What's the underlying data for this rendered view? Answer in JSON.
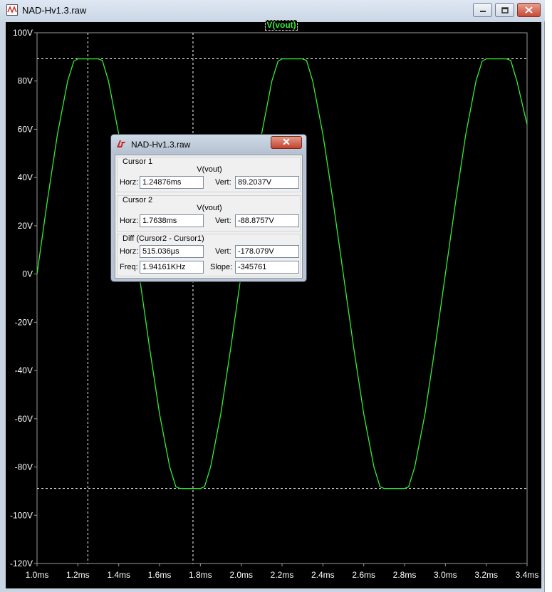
{
  "window": {
    "title": "NAD-Hv1.3.raw",
    "icon": "ltspice-waveform-icon",
    "controls": [
      "minimize-icon",
      "maximize-icon",
      "close-icon"
    ]
  },
  "trace_label": "V(vout)",
  "colors": {
    "trace": "#33ee33",
    "background": "#000000",
    "axis_text": "#ffffff",
    "cursor_line": "#ffffff"
  },
  "chart_data": {
    "type": "line",
    "xlabel": "",
    "ylabel": "",
    "x_unit": "ms",
    "y_unit": "V",
    "xlim": [
      1.0,
      3.4
    ],
    "ylim": [
      -120,
      100
    ],
    "x_ticks": [
      "1.0ms",
      "1.2ms",
      "1.4ms",
      "1.6ms",
      "1.8ms",
      "2.0ms",
      "2.2ms",
      "2.4ms",
      "2.6ms",
      "2.8ms",
      "3.0ms",
      "3.2ms",
      "3.4ms"
    ],
    "y_ticks": [
      "100V",
      "80V",
      "60V",
      "40V",
      "20V",
      "0V",
      "-20V",
      "-40V",
      "-60V",
      "-80V",
      "-100V",
      "-120V"
    ],
    "grid": false,
    "series": [
      {
        "name": "V(vout)",
        "x": [
          1.0,
          1.05,
          1.1,
          1.15,
          1.18,
          1.2,
          1.22,
          1.25,
          1.28,
          1.3,
          1.32,
          1.35,
          1.4,
          1.45,
          1.5,
          1.55,
          1.6,
          1.65,
          1.68,
          1.7,
          1.72,
          1.75,
          1.78,
          1.8,
          1.82,
          1.85,
          1.9,
          1.95,
          2.0,
          2.05,
          2.1,
          2.15,
          2.18,
          2.2,
          2.22,
          2.25,
          2.28,
          2.3,
          2.32,
          2.35,
          2.4,
          2.45,
          2.5,
          2.55,
          2.6,
          2.65,
          2.68,
          2.7,
          2.72,
          2.75,
          2.78,
          2.8,
          2.82,
          2.85,
          2.9,
          2.95,
          3.0,
          3.05,
          3.1,
          3.15,
          3.18,
          3.2,
          3.22,
          3.25,
          3.28,
          3.3,
          3.32,
          3.35,
          3.4
        ],
        "y": [
          0,
          30,
          58,
          80,
          88.2,
          89.2,
          89.2,
          89.2,
          89.2,
          89.2,
          88.5,
          80,
          58,
          30,
          0,
          -30,
          -58,
          -80,
          -88.2,
          -88.9,
          -88.9,
          -88.9,
          -88.9,
          -88.9,
          -88.2,
          -80,
          -58,
          -30,
          0,
          30,
          58,
          80,
          88.2,
          89.2,
          89.2,
          89.2,
          89.2,
          89.2,
          88.5,
          80,
          58,
          30,
          0,
          -30,
          -58,
          -80,
          -88.2,
          -88.9,
          -88.9,
          -88.9,
          -88.9,
          -88.9,
          -88.2,
          -80,
          -58,
          -30,
          0,
          30,
          58,
          80,
          88.2,
          89.2,
          89.2,
          89.2,
          89.2,
          89.2,
          88.5,
          80,
          62
        ]
      }
    ],
    "cursors": {
      "cursor1": {
        "x": 1.24876,
        "y": 89.2037
      },
      "cursor2": {
        "x": 1.7638,
        "y": -88.8757
      }
    }
  },
  "dialog": {
    "title": "NAD-Hv1.3.raw",
    "close_glyph": "✕",
    "cursor1": {
      "title": "Cursor 1",
      "signal": "V(vout)",
      "horz_label": "Horz:",
      "horz_value": "1.24876ms",
      "vert_label": "Vert:",
      "vert_value": "89.2037V"
    },
    "cursor2": {
      "title": "Cursor 2",
      "signal": "V(vout)",
      "horz_label": "Horz:",
      "horz_value": "1.7638ms",
      "vert_label": "Vert:",
      "vert_value": "-88.8757V"
    },
    "diff": {
      "title": "Diff (Cursor2 - Cursor1)",
      "horz_label": "Horz:",
      "horz_value": "515.036µs",
      "vert_label": "Vert:",
      "vert_value": "-178.079V",
      "freq_label": "Freq:",
      "freq_value": "1.94161KHz",
      "slope_label": "Slope:",
      "slope_value": "-345761"
    }
  }
}
